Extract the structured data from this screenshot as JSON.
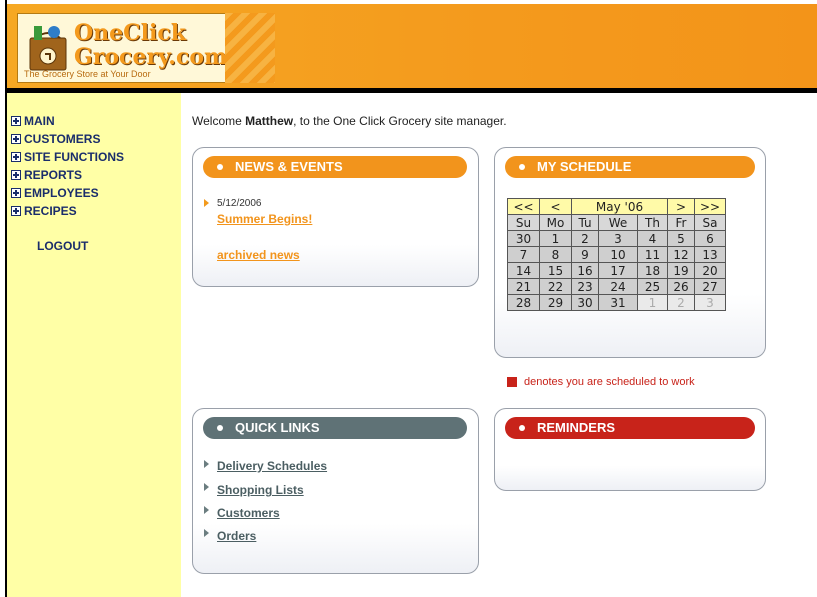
{
  "brand": {
    "line1": "OneClick",
    "line2": "Grocery.com",
    "tagline": "The Grocery Store at Your Door"
  },
  "sidebar": {
    "items": [
      {
        "label": "MAIN"
      },
      {
        "label": "CUSTOMERS"
      },
      {
        "label": "SITE FUNCTIONS"
      },
      {
        "label": "REPORTS"
      },
      {
        "label": "EMPLOYEES"
      },
      {
        "label": "RECIPES"
      }
    ],
    "logout": "LOGOUT"
  },
  "welcome": {
    "prefix": "Welcome ",
    "user": "Matthew",
    "suffix": ", to the One Click Grocery site manager."
  },
  "news": {
    "title": "NEWS & EVENTS",
    "date": "5/12/2006",
    "headline": "Summer Begins!",
    "archived": "archived news"
  },
  "schedule": {
    "title": "MY SCHEDULE",
    "nav": {
      "prev_year": "<<",
      "prev": "<",
      "month": "May '06",
      "next": ">",
      "next_year": ">>"
    },
    "days": [
      "Su",
      "Mo",
      "Tu",
      "We",
      "Th",
      "Fr",
      "Sa"
    ],
    "weeks": [
      [
        "30",
        "1",
        "2",
        "3",
        "4",
        "5",
        "6"
      ],
      [
        "7",
        "8",
        "9",
        "10",
        "11",
        "12",
        "13"
      ],
      [
        "14",
        "15",
        "16",
        "17",
        "18",
        "19",
        "20"
      ],
      [
        "21",
        "22",
        "23",
        "24",
        "25",
        "26",
        "27"
      ],
      [
        "28",
        "29",
        "30",
        "31",
        "1",
        "2",
        "3"
      ]
    ],
    "legend": "denotes you are scheduled to work"
  },
  "quick_links": {
    "title": "QUICK LINKS",
    "items": [
      "Delivery Schedules",
      "Shopping Lists",
      "Customers",
      "Orders"
    ]
  },
  "reminders": {
    "title": "REMINDERS"
  },
  "colors": {
    "accent_orange": "#f2941c",
    "slate": "#5f7276",
    "alert_red": "#c8231a",
    "sidebar_bg": "#ffffa6"
  }
}
